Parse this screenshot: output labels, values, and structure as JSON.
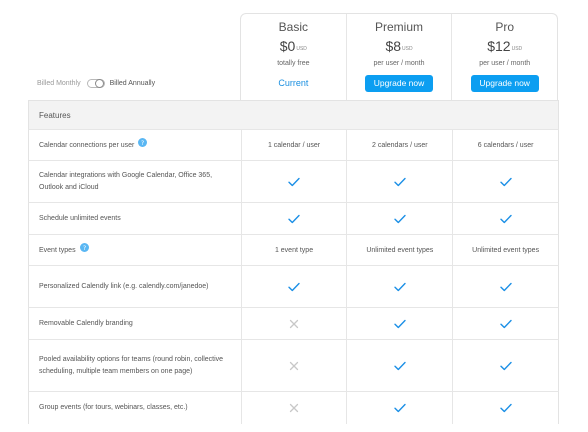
{
  "billing": {
    "monthly_label": "Billed Monthly",
    "annual_label": "Billed Annually",
    "annual_selected": true
  },
  "plans": [
    {
      "name": "Basic",
      "price": "$0",
      "currency": "USD",
      "subtitle": "totally free",
      "action": "Current",
      "action_type": "link"
    },
    {
      "name": "Premium",
      "price": "$8",
      "currency": "USD",
      "subtitle": "per user / month",
      "action": "Upgrade now",
      "action_type": "button"
    },
    {
      "name": "Pro",
      "price": "$12",
      "currency": "USD",
      "subtitle": "per user / month",
      "action": "Upgrade now",
      "action_type": "button"
    }
  ],
  "section_title": "Features",
  "features": [
    {
      "label": "Calendar connections per user",
      "help": true,
      "height": 31,
      "values": [
        "1 calendar / user",
        "2 calendars / user",
        "6 calendars / user"
      ]
    },
    {
      "label": "Calendar integrations with Google Calendar, Office 365, Outlook and iCloud",
      "help": false,
      "height": 42,
      "values": [
        "check",
        "check",
        "check"
      ]
    },
    {
      "label": "Schedule unlimited events",
      "help": false,
      "height": 32,
      "values": [
        "check",
        "check",
        "check"
      ]
    },
    {
      "label": "Event types",
      "help": true,
      "height": 31,
      "values": [
        "1 event type",
        "Unlimited event types",
        "Unlimited event types"
      ]
    },
    {
      "label": "Personalized Calendly link (e.g. calendly.com/janedoe)",
      "help": false,
      "height": 42,
      "values": [
        "check",
        "check",
        "check"
      ]
    },
    {
      "label": "Removable Calendly branding",
      "help": false,
      "height": 32,
      "values": [
        "cross",
        "check",
        "check"
      ]
    },
    {
      "label": "Pooled availability options for teams (round robin, collective scheduling, multiple team members on one page)",
      "help": false,
      "height": 52,
      "values": [
        "cross",
        "check",
        "check"
      ]
    },
    {
      "label": "Group events (for tours, webinars, classes, etc.)",
      "help": false,
      "height": 33,
      "values": [
        "cross",
        "check",
        "check"
      ]
    }
  ],
  "colors": {
    "accent": "#0c9ef1",
    "link": "#1a8fe0",
    "check": "#1b8fe6",
    "cross": "#c8c8c8",
    "help": "#5ab7f3"
  }
}
